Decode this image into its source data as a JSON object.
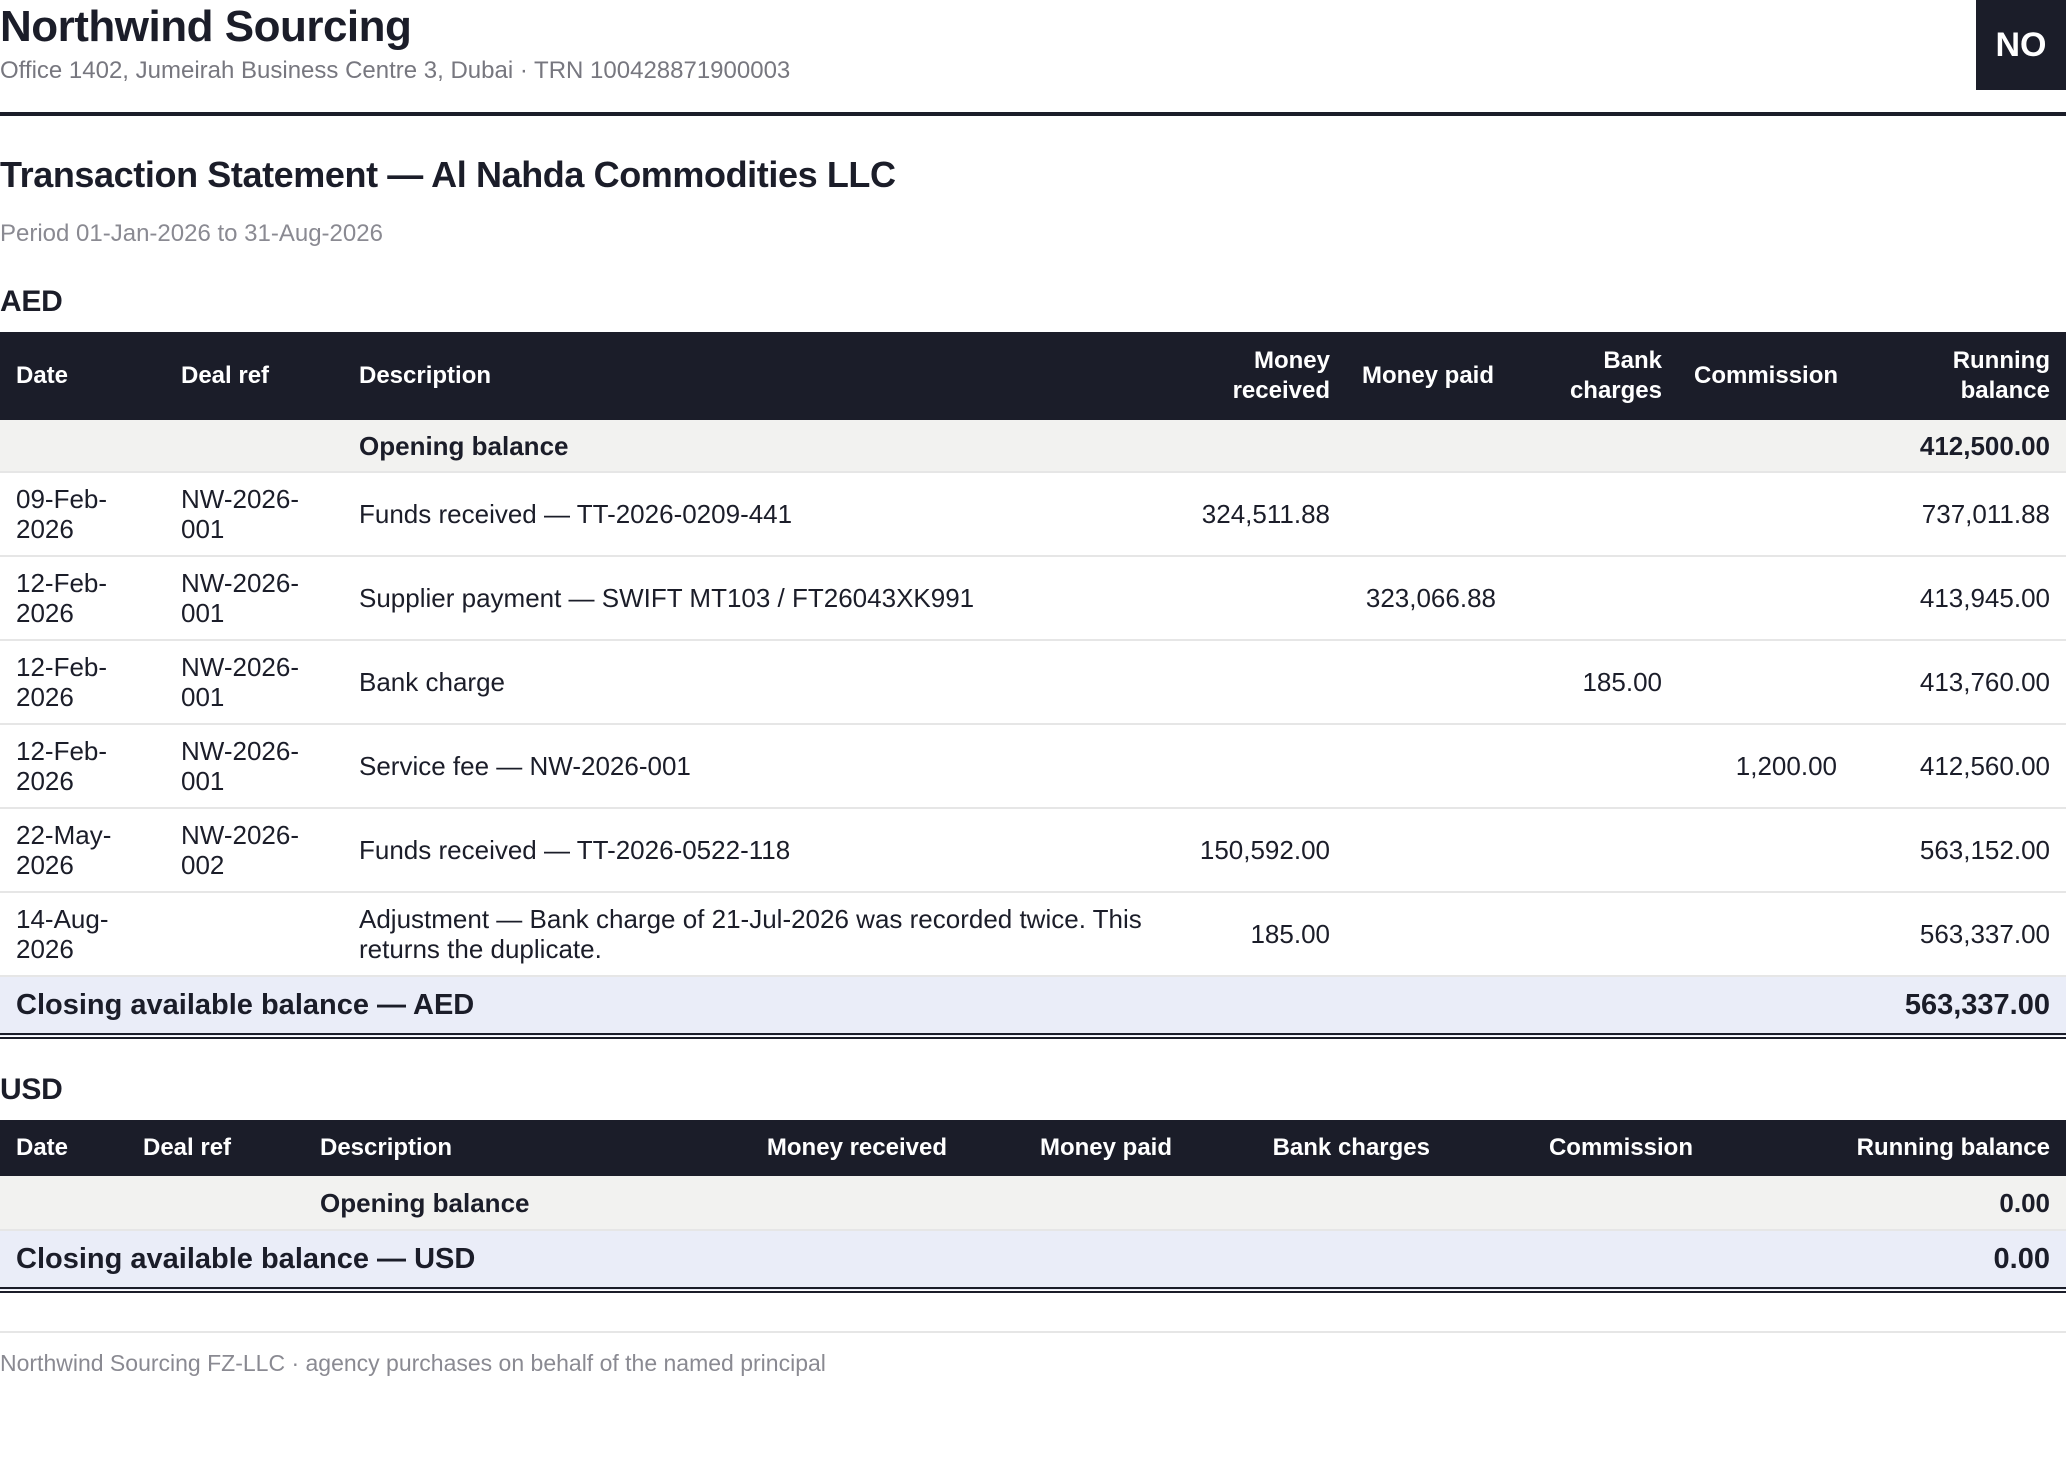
{
  "company": {
    "name": "Northwind Sourcing",
    "address": "Office 1402, Jumeirah Business Centre 3, Dubai · TRN 100428871900003",
    "initials": "NO"
  },
  "statement": {
    "title": "Transaction Statement — Al Nahda Commodities LLC",
    "period": "Period 01-Jan-2026 to 31-Aug-2026"
  },
  "columns": {
    "date": "Date",
    "deal_ref": "Deal ref",
    "description": "Description",
    "money_received": "Money received",
    "money_paid": "Money paid",
    "bank_charges": "Bank charges",
    "commission": "Commission",
    "running_balance": "Running balance"
  },
  "aed": {
    "currency": "AED",
    "opening_label": "Opening balance",
    "opening_balance": "412,500.00",
    "rows": [
      {
        "date": "09-Feb-2026",
        "deal_ref": "NW-2026-001",
        "description": "Funds received — TT-2026-0209-441",
        "money_received": "324,511.88",
        "money_paid": "",
        "bank_charges": "",
        "commission": "",
        "running_balance": "737,011.88"
      },
      {
        "date": "12-Feb-2026",
        "deal_ref": "NW-2026-001",
        "description": "Supplier payment — SWIFT MT103 / FT26043XK991",
        "money_received": "",
        "money_paid": "323,066.88",
        "bank_charges": "",
        "commission": "",
        "running_balance": "413,945.00"
      },
      {
        "date": "12-Feb-2026",
        "deal_ref": "NW-2026-001",
        "description": "Bank charge",
        "money_received": "",
        "money_paid": "",
        "bank_charges": "185.00",
        "commission": "",
        "running_balance": "413,760.00"
      },
      {
        "date": "12-Feb-2026",
        "deal_ref": "NW-2026-001",
        "description": "Service fee — NW-2026-001",
        "money_received": "",
        "money_paid": "",
        "bank_charges": "",
        "commission": "1,200.00",
        "running_balance": "412,560.00"
      },
      {
        "date": "22-May-2026",
        "deal_ref": "NW-2026-002",
        "description": "Funds received — TT-2026-0522-118",
        "money_received": "150,592.00",
        "money_paid": "",
        "bank_charges": "",
        "commission": "",
        "running_balance": "563,152.00"
      },
      {
        "date": "14-Aug-2026",
        "deal_ref": "",
        "description": "Adjustment — Bank charge of 21-Jul-2026 was recorded twice. This returns the duplicate.",
        "money_received": "185.00",
        "money_paid": "",
        "bank_charges": "",
        "commission": "",
        "running_balance": "563,337.00"
      }
    ],
    "closing_label": "Closing available balance — AED",
    "closing_balance": "563,337.00"
  },
  "usd": {
    "currency": "USD",
    "opening_label": "Opening balance",
    "opening_balance": "0.00",
    "closing_label": "Closing available balance — USD",
    "closing_balance": "0.00"
  },
  "footer": {
    "note": "Northwind Sourcing FZ-LLC · agency purchases on behalf of the named principal"
  },
  "colors": {
    "header_dark": "#1b1d29",
    "opening_row_bg": "#f2f2f0",
    "closing_row_bg": "#eaedf8",
    "muted_text": "#8a8a92"
  }
}
